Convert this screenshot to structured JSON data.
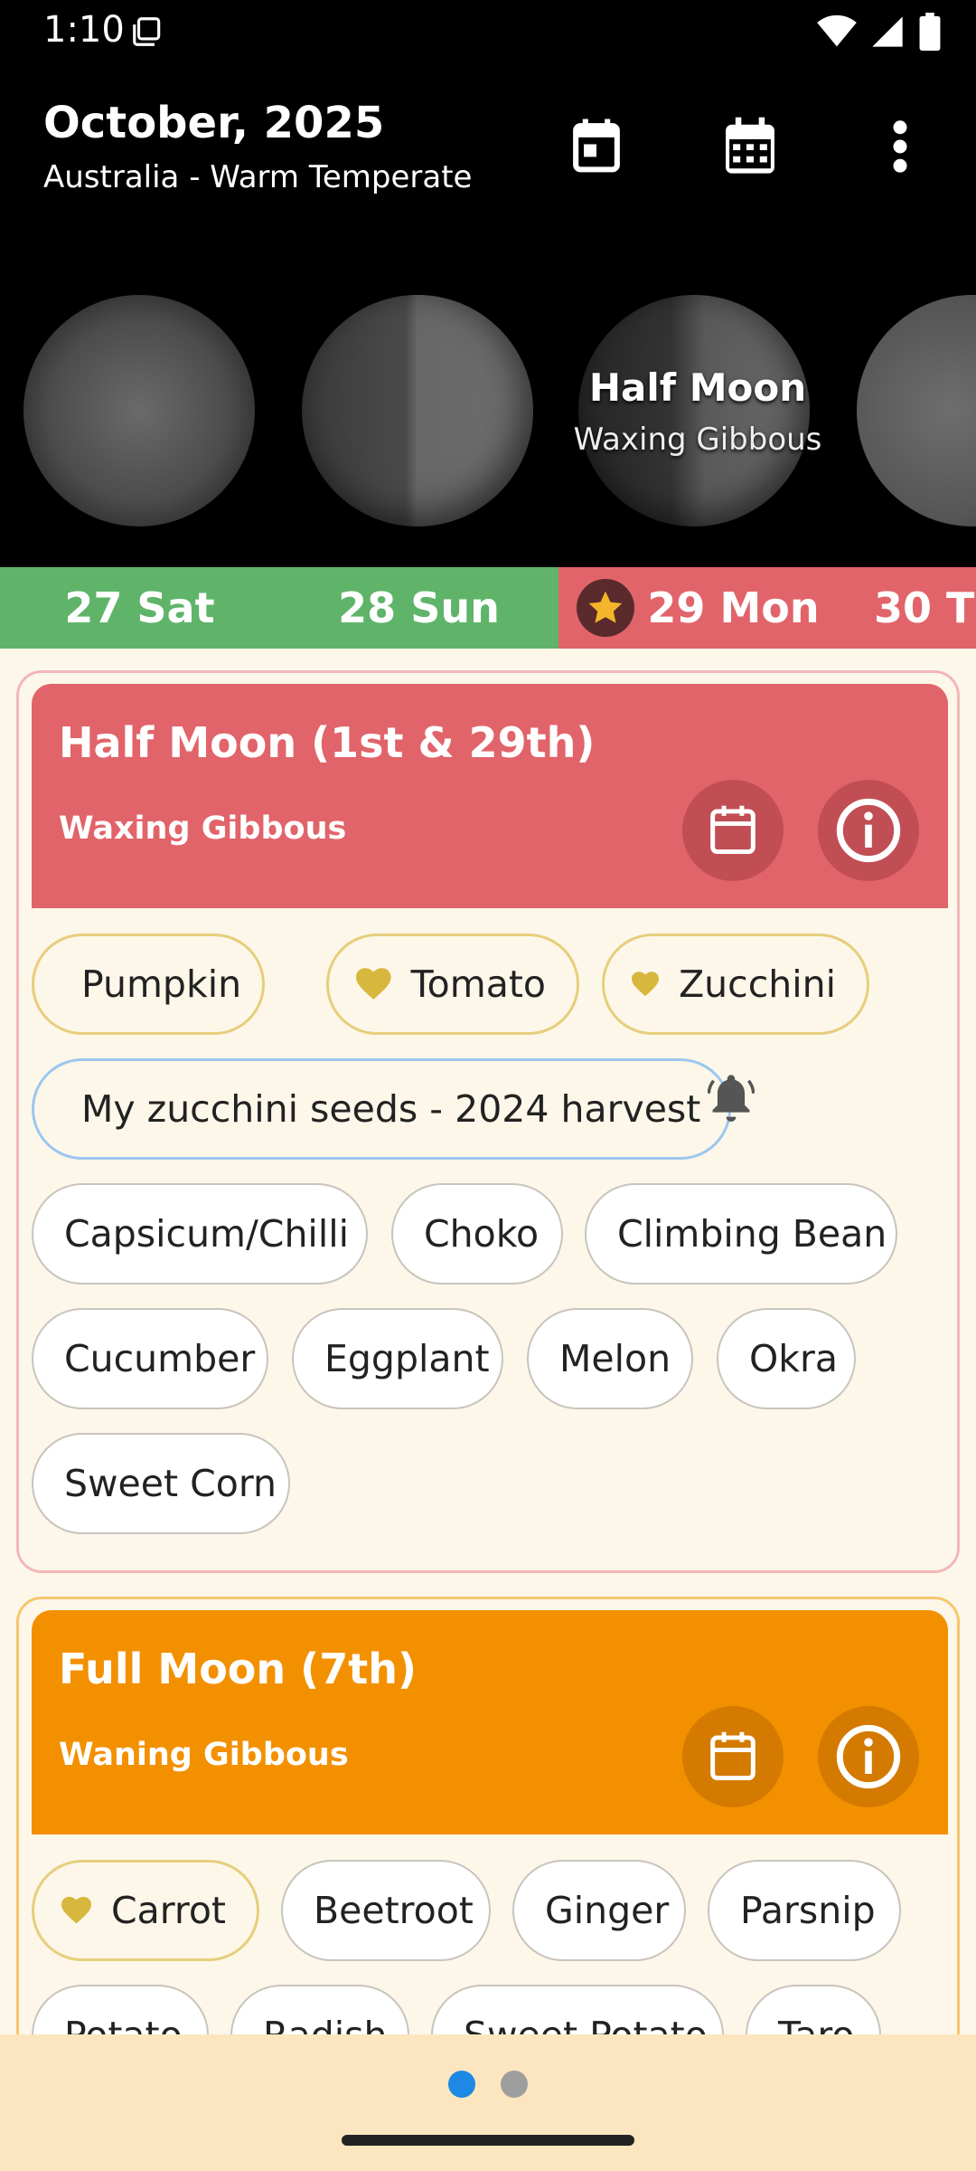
{
  "status_bar": {
    "time": "1:10"
  },
  "header": {
    "title": "October, 2025",
    "subtitle": "Australia - Warm Temperate",
    "icons": [
      "calendar-day-icon",
      "calendar-month-icon",
      "more-vertical-icon"
    ]
  },
  "moon_carousel": {
    "current_title": "Half Moon",
    "current_subtitle": "Waxing Gibbous"
  },
  "days": [
    {
      "label": "27 Sat",
      "color": "#5fb46a"
    },
    {
      "label": "28 Sun",
      "color": "#5fb46a"
    },
    {
      "label": "29 Mon",
      "color": "#e1646a",
      "starred": true
    },
    {
      "label": "30 T",
      "color": "#e1646a"
    }
  ],
  "cards": [
    {
      "title": "Half Moon (1st & 29th)",
      "subtitle": "Waxing Gibbous",
      "color": "#e1646a",
      "favorites": [
        "Pumpkin",
        "Tomato",
        "Zucchini"
      ],
      "custom": "My zucchini seeds - 2024 harvest",
      "plants": [
        "Capsicum/Chilli",
        "Choko",
        "Climbing Bean",
        "Cucumber",
        "Eggplant",
        "Melon",
        "Okra",
        "Sweet Corn"
      ]
    },
    {
      "title": "Full Moon (7th)",
      "subtitle": "Waning Gibbous",
      "color": "#f39000",
      "favorites": [
        "Carrot"
      ],
      "plants": [
        "Beetroot",
        "Ginger",
        "Parsnip",
        "Potato",
        "Radish",
        "Sweet Potato",
        "Taro"
      ]
    }
  ],
  "pager": {
    "pages": 2,
    "active": 0
  },
  "colors": {
    "accent": "#1e88e5",
    "favorite_gold": "#d8b73e",
    "background": "#fdf7ea"
  }
}
